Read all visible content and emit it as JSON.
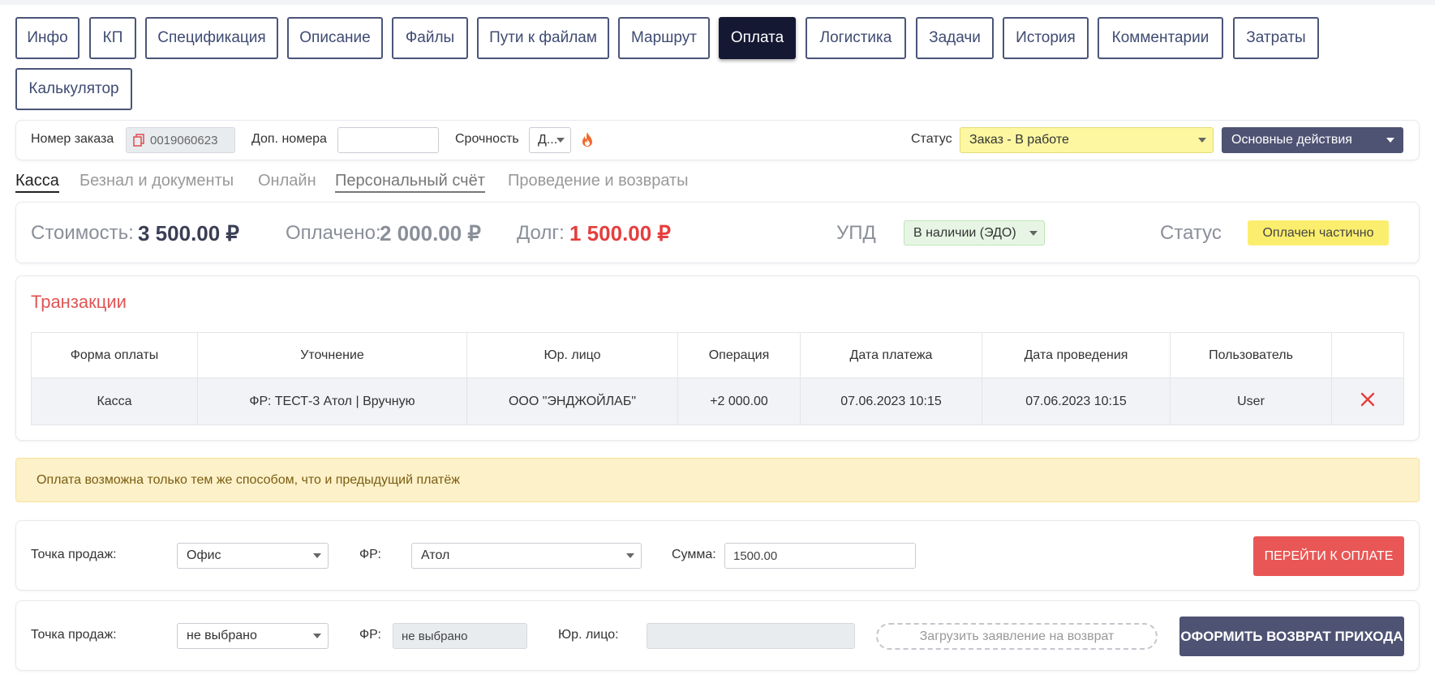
{
  "tabs": [
    {
      "label": "Инфо"
    },
    {
      "label": "КП"
    },
    {
      "label": "Спецификация"
    },
    {
      "label": "Описание"
    },
    {
      "label": "Файлы"
    },
    {
      "label": "Пути к файлам"
    },
    {
      "label": "Маршрут"
    },
    {
      "label": "Оплата",
      "active": true
    },
    {
      "label": "Логистика"
    },
    {
      "label": "Задачи"
    },
    {
      "label": "История"
    },
    {
      "label": "Комментарии"
    },
    {
      "label": "Затраты"
    },
    {
      "label": "Калькулятор"
    }
  ],
  "order": {
    "number_label": "Номер заказа",
    "number_value": "0019060623",
    "extra_label": "Доп. номера",
    "extra_value": "",
    "urgency_label": "Срочность",
    "urgency_value": "Д...",
    "fire_icon": "fire-icon",
    "status_label": "Статус",
    "status_value": "Заказ - В работе",
    "actions_label": "Основные действия"
  },
  "subtabs": [
    {
      "label": "Касса"
    },
    {
      "label": "Безнал и документы"
    },
    {
      "label": "Онлайн"
    },
    {
      "label": "Персональный счёт"
    },
    {
      "label": "Проведение и возвраты"
    }
  ],
  "summary": {
    "cost_label": "Стоимость:",
    "cost_value": "3 500.00 ₽",
    "paid_label": "Оплачено:",
    "paid_value": "2 000.00 ₽",
    "debt_label": "Долг:",
    "debt_value": "1 500.00 ₽",
    "upd_label": "УПД",
    "upd_value": "В наличии (ЭДО)",
    "status_label": "Статус",
    "status_value": "Оплачен частично"
  },
  "transactions": {
    "title": "Транзакции",
    "columns": [
      "Форма оплаты",
      "Уточнение",
      "Юр. лицо",
      "Операция",
      "Дата платежа",
      "Дата проведения",
      "Пользователь",
      ""
    ],
    "rows": [
      [
        "Касса",
        "ФР: ТЕСТ-3 Атол | Вручную",
        "ООО \"ЭНДЖОЙЛАБ\"",
        "+2 000.00",
        "07.06.2023 10:15",
        "07.06.2023 10:15",
        "User"
      ]
    ],
    "delete_icon": "close-icon"
  },
  "alert": "Оплата возможна только тем же способом, что и предыдущий платёж",
  "payment_form": {
    "pos_label": "Точка продаж:",
    "pos_value": "Офис",
    "fr_label": "ФР:",
    "fr_value": "Атол",
    "sum_label": "Сумма:",
    "sum_value": "1500.00",
    "pay_button": "ПЕРЕЙТИ К ОПЛАТЕ"
  },
  "refund_form": {
    "pos_label": "Точка продаж:",
    "pos_value": "не выбрано",
    "fr_label": "ФР:",
    "fr_value": "не выбрано",
    "entity_label": "Юр. лицо:",
    "entity_value": "",
    "upload_label": "Загрузить заявление на возврат",
    "refund_button": "ОФОРМИТЬ ВОЗВРАТ ПРИХОДА"
  },
  "colors": {
    "active_tab": "#151833",
    "debt": "#e53e3e",
    "title_red": "#e05555",
    "status_yellow": "#fbee6e",
    "pay_button": "#e85755",
    "refund_button": "#4e5373"
  }
}
